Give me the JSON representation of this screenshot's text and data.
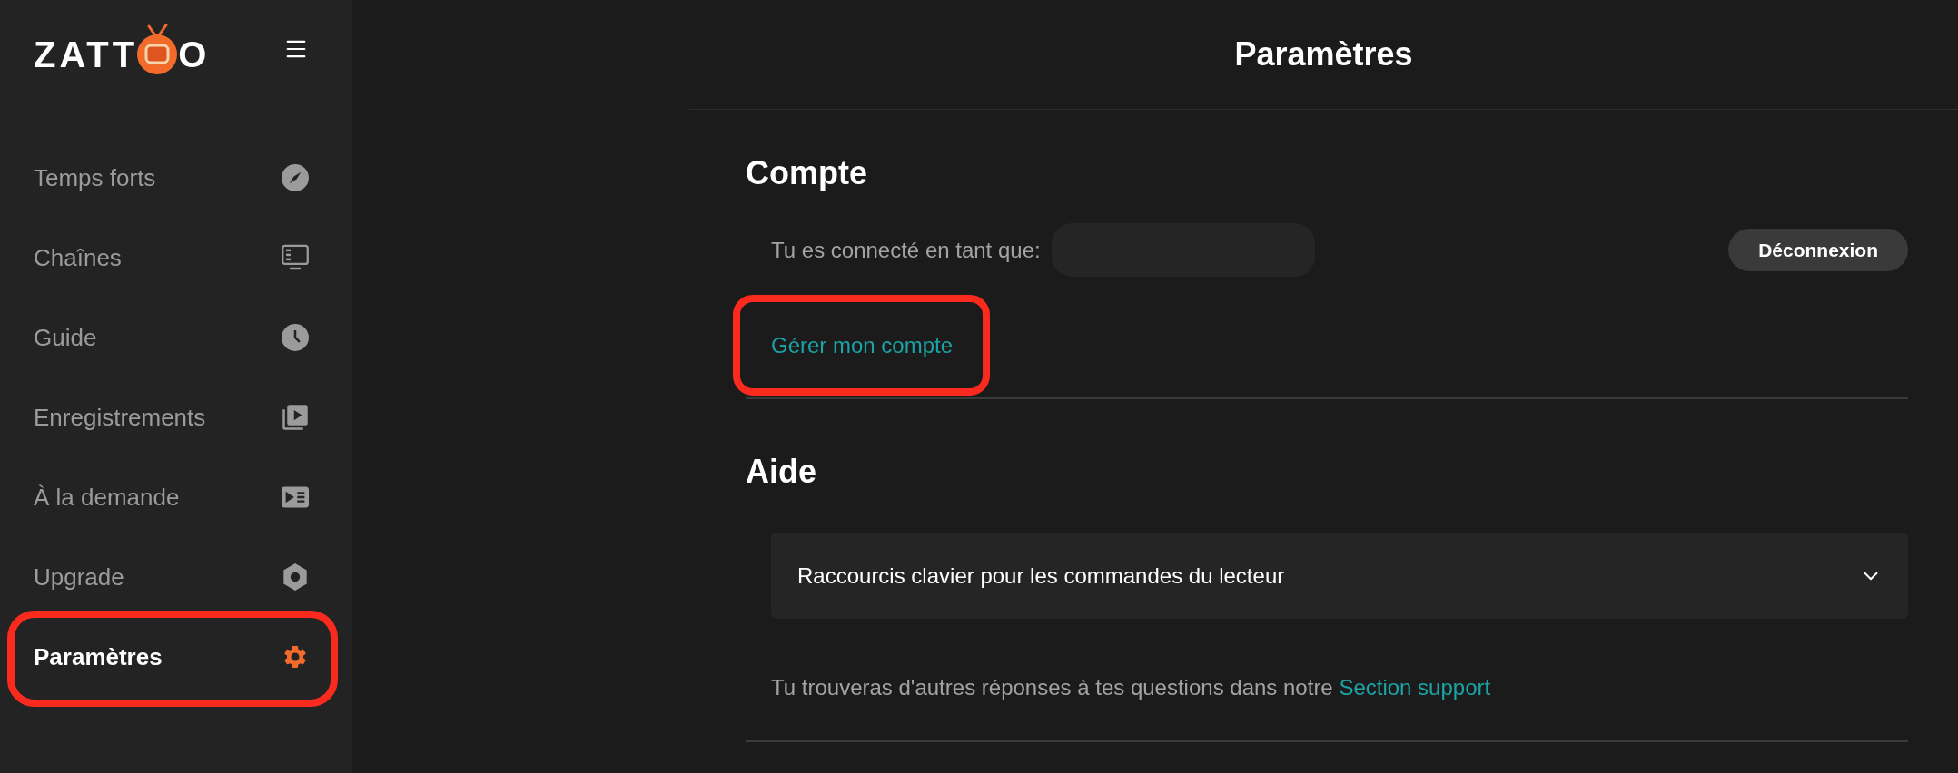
{
  "sidebar": {
    "logo": {
      "leading": "ZATT",
      "trailing": "O"
    },
    "items": [
      {
        "label": "Temps forts",
        "selected": false,
        "highlighted": false
      },
      {
        "label": "Chaînes",
        "selected": false,
        "highlighted": false
      },
      {
        "label": "Guide",
        "selected": false,
        "highlighted": false
      },
      {
        "label": "Enregistrements",
        "selected": false,
        "highlighted": false
      },
      {
        "label": "À la demande",
        "selected": false,
        "highlighted": false
      },
      {
        "label": "Upgrade",
        "selected": false,
        "highlighted": false
      },
      {
        "label": "Paramètres",
        "selected": true,
        "highlighted": true
      }
    ]
  },
  "header": {
    "title": "Paramètres"
  },
  "sections": [
    {
      "kind": "account",
      "title": "Compte",
      "signed_in_label": "Tu es connecté en tant que:",
      "logout_button": "Déconnexion",
      "manage_link": {
        "label": "Gérer mon compte",
        "highlighted": true
      }
    },
    {
      "kind": "help",
      "title": "Aide",
      "accordion": {
        "label": "Raccourcis clavier pour les commandes du lecteur",
        "expanded": false
      },
      "support_text": "Tu trouveras d'autres réponses à tes questions dans notre",
      "support_link": "Section support"
    }
  ]
}
